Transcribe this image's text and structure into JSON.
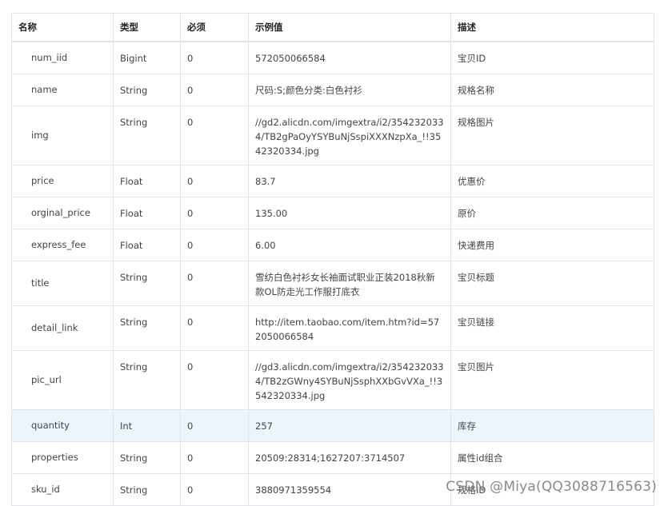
{
  "table": {
    "headers": [
      "名称",
      "类型",
      "必须",
      "示例值",
      "描述"
    ],
    "rows": [
      {
        "name": "num_iid",
        "type": "Bigint",
        "required": "0",
        "example": "572050066584",
        "desc": "宝贝ID"
      },
      {
        "name": "name",
        "type": "String",
        "required": "0",
        "example": "尺码:S;颜色分类:白色衬衫",
        "desc": "规格名称"
      },
      {
        "name": "img",
        "type": "String",
        "required": "0",
        "example": "//gd2.alicdn.com/imgextra/i2/3542320334/TB2gPaOyYSYBuNjSspiXXXNzpXa_!!3542320334.jpg",
        "desc": "规格图片"
      },
      {
        "name": "price",
        "type": "Float",
        "required": "0",
        "example": "83.7",
        "desc": "优惠价"
      },
      {
        "name": "orginal_price",
        "type": "Float",
        "required": "0",
        "example": "135.00",
        "desc": "原价"
      },
      {
        "name": "express_fee",
        "type": "Float",
        "required": "0",
        "example": "6.00",
        "desc": "快递费用"
      },
      {
        "name": "title",
        "type": "String",
        "required": "0",
        "example": "雪纺白色衬衫女长袖面试职业正装2018秋新款OL防走光工作服打底衣",
        "desc": "宝贝标题"
      },
      {
        "name": "detail_link",
        "type": "String",
        "required": "0",
        "example": "http://item.taobao.com/item.htm?id=572050066584",
        "desc": "宝贝链接"
      },
      {
        "name": "pic_url",
        "type": "String",
        "required": "0",
        "example": "//gd3.alicdn.com/imgextra/i2/3542320334/TB2zGWny4SYBuNjSsphXXbGvVXa_!!3542320334.jpg",
        "desc": "宝贝图片"
      },
      {
        "name": "quantity",
        "type": "Int",
        "required": "0",
        "example": "257",
        "desc": "库存",
        "highlight": true
      },
      {
        "name": "properties",
        "type": "String",
        "required": "0",
        "example": "20509:28314;1627207:3714507",
        "desc": "属性id组合"
      },
      {
        "name": "sku_id",
        "type": "String",
        "required": "0",
        "example": "3880971359554",
        "desc": "规格ID"
      }
    ]
  },
  "watermark": "CSDN @Miya(QQ3088716563)",
  "colors": {
    "border": "#e1e4e8",
    "highlight_row": "#edf5fc",
    "text": "#444444"
  }
}
